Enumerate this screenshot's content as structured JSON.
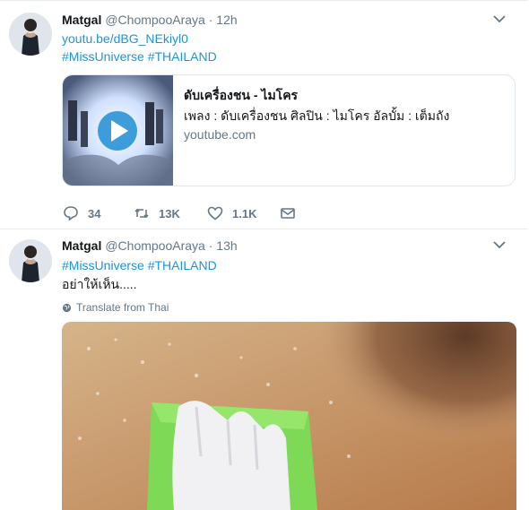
{
  "tweets": [
    {
      "name": "Matgal",
      "handle": "@ChompooAraya",
      "separator": "·",
      "time": "12h",
      "link": "youtu.be/dBG_NEkiyl0",
      "hashtags": "#MissUniverse #THAILAND",
      "card": {
        "title": "ดับเครื่องชน - ไมโคร",
        "description": "เพลง : ดับเครื่องชน ศิลปิน : ไมโคร อัลบั้ม : เต็มถัง",
        "domain": "youtube.com"
      },
      "actions": {
        "replies": "34",
        "retweets": "13K",
        "likes": "1.1K"
      }
    },
    {
      "name": "Matgal",
      "handle": "@ChompooAraya",
      "separator": "·",
      "time": "13h",
      "hashtags": "#MissUniverse #THAILAND",
      "text": "อย่าให้เห็น.....",
      "translate": "Translate from Thai"
    }
  ],
  "colors": {
    "link": "#1b95e0",
    "meta": "#657786",
    "border": "#e6ecf0"
  }
}
